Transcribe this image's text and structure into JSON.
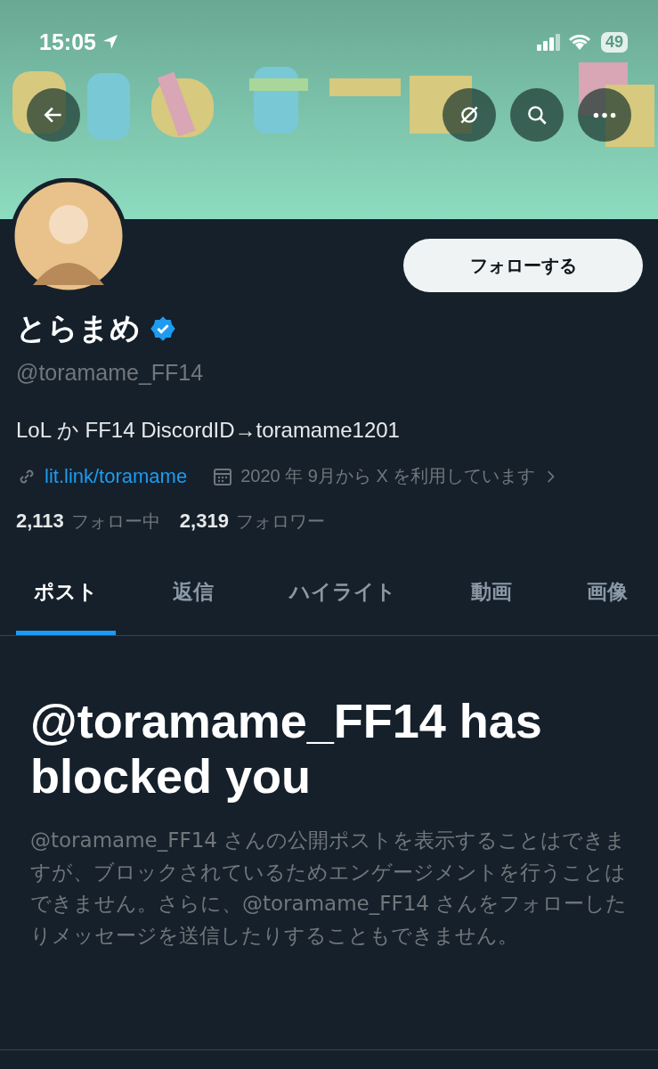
{
  "status_bar": {
    "time": "15:05",
    "battery": "49"
  },
  "profile": {
    "follow_button": "フォローする",
    "name": "とらまめ",
    "verified": true,
    "handle": "@toramame_FF14",
    "bio": "LoL か FF14 DiscordID→toramame1201",
    "link": "lit.link/toramame",
    "joined": "2020 年 9月から X を利用しています",
    "following_count": "2,113",
    "following_label": "フォロー中",
    "followers_count": "2,319",
    "followers_label": "フォロワー"
  },
  "tabs": [
    {
      "label": "ポスト",
      "selected": true
    },
    {
      "label": "返信",
      "selected": false
    },
    {
      "label": "ハイライト",
      "selected": false
    },
    {
      "label": "動画",
      "selected": false
    },
    {
      "label": "画像",
      "selected": false
    }
  ],
  "notice": {
    "title": "@toramame_FF14 has blocked you",
    "body": "@toramame_FF14 さんの公開ポストを表示することはできますが、ブロックされているためエンゲージメントを行うことはできません。さらに、@toramame_FF14 さんをフォローしたりメッセージを送信したりすることもできません。"
  }
}
